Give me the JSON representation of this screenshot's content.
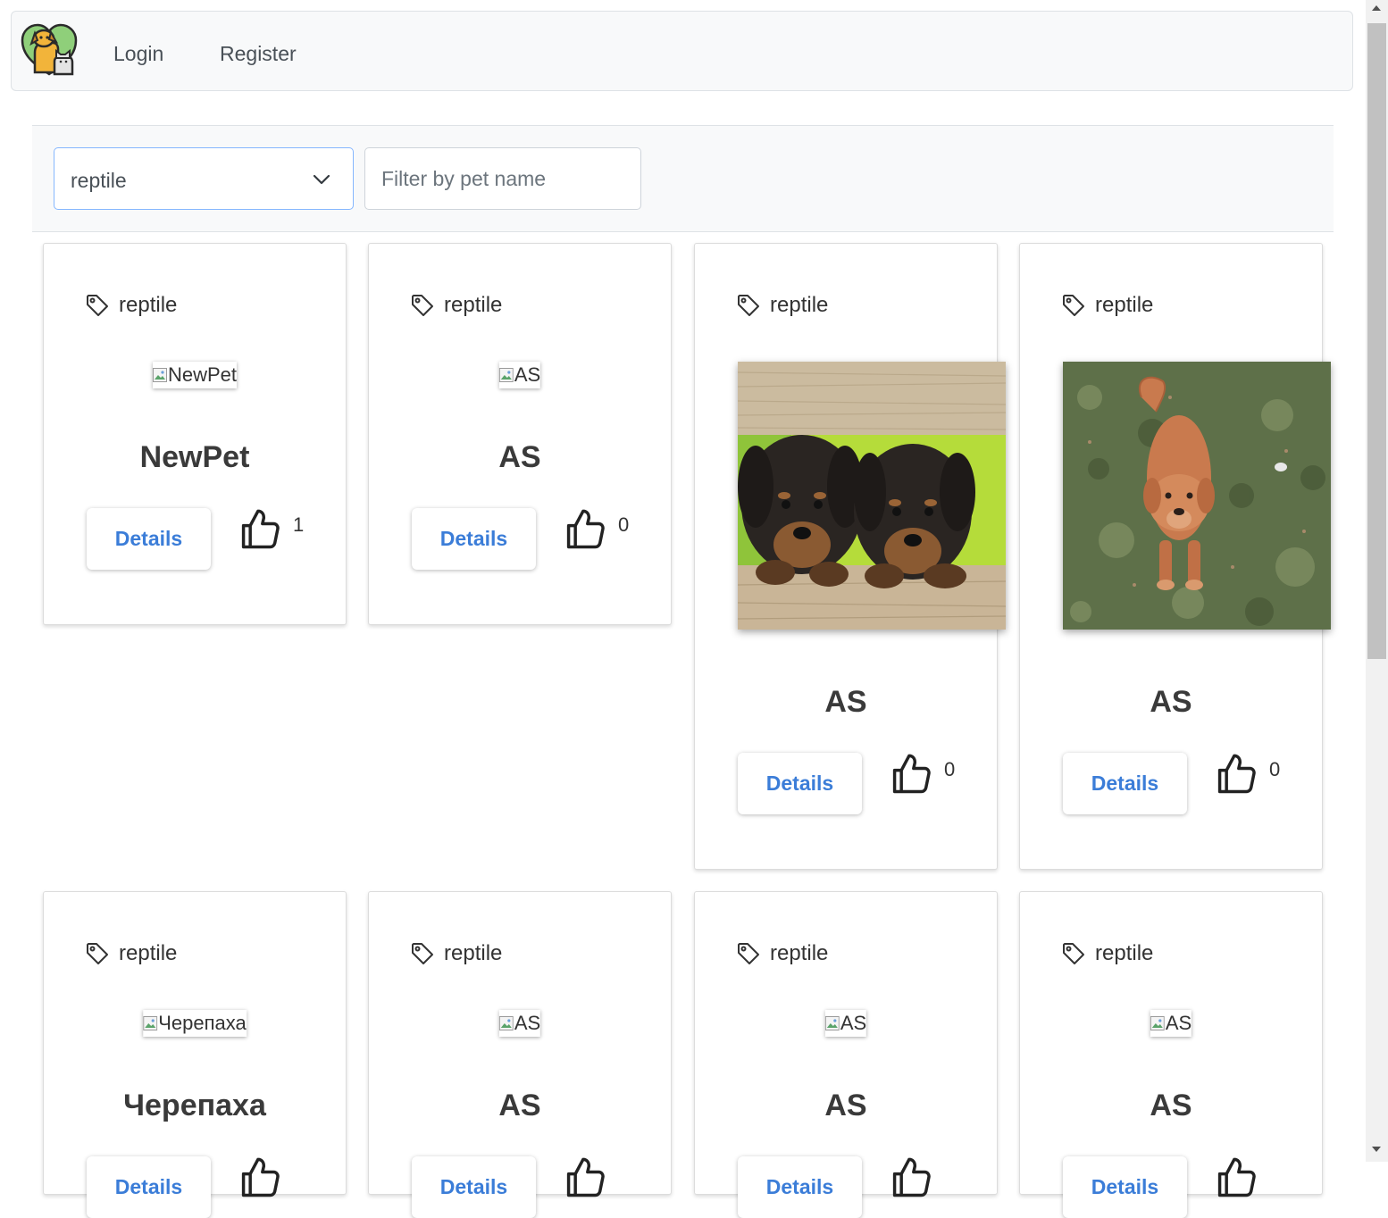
{
  "nav": {
    "login": "Login",
    "register": "Register"
  },
  "filter": {
    "selected_type": "reptile",
    "name_placeholder": "Filter by pet name"
  },
  "cards": [
    {
      "tag": "reptile",
      "image_alt": "NewPet",
      "name": "NewPet",
      "details": "Details",
      "likes": "1"
    },
    {
      "tag": "reptile",
      "image_alt": "AS",
      "name": "AS",
      "details": "Details",
      "likes": "0"
    },
    {
      "tag": "reptile",
      "image_alt": "",
      "name": "AS",
      "details": "Details",
      "likes": "0"
    },
    {
      "tag": "reptile",
      "image_alt": "",
      "name": "AS",
      "details": "Details",
      "likes": "0"
    },
    {
      "tag": "reptile",
      "image_alt": "Черепаха",
      "name": "Черепаха",
      "details": "Details",
      "likes": ""
    },
    {
      "tag": "reptile",
      "image_alt": "AS",
      "name": "AS",
      "details": "Details",
      "likes": ""
    },
    {
      "tag": "reptile",
      "image_alt": "AS",
      "name": "AS",
      "details": "Details",
      "likes": ""
    },
    {
      "tag": "reptile",
      "image_alt": "AS",
      "name": "AS",
      "details": "Details",
      "likes": ""
    }
  ],
  "icons": {
    "logo": "pets-logo-icon",
    "tag": "tag-icon",
    "like": "thumbs-up-icon",
    "select": "chevron-down-icon"
  },
  "colors": {
    "accent": "#3b7dd8",
    "select_border": "#86b7fe"
  }
}
